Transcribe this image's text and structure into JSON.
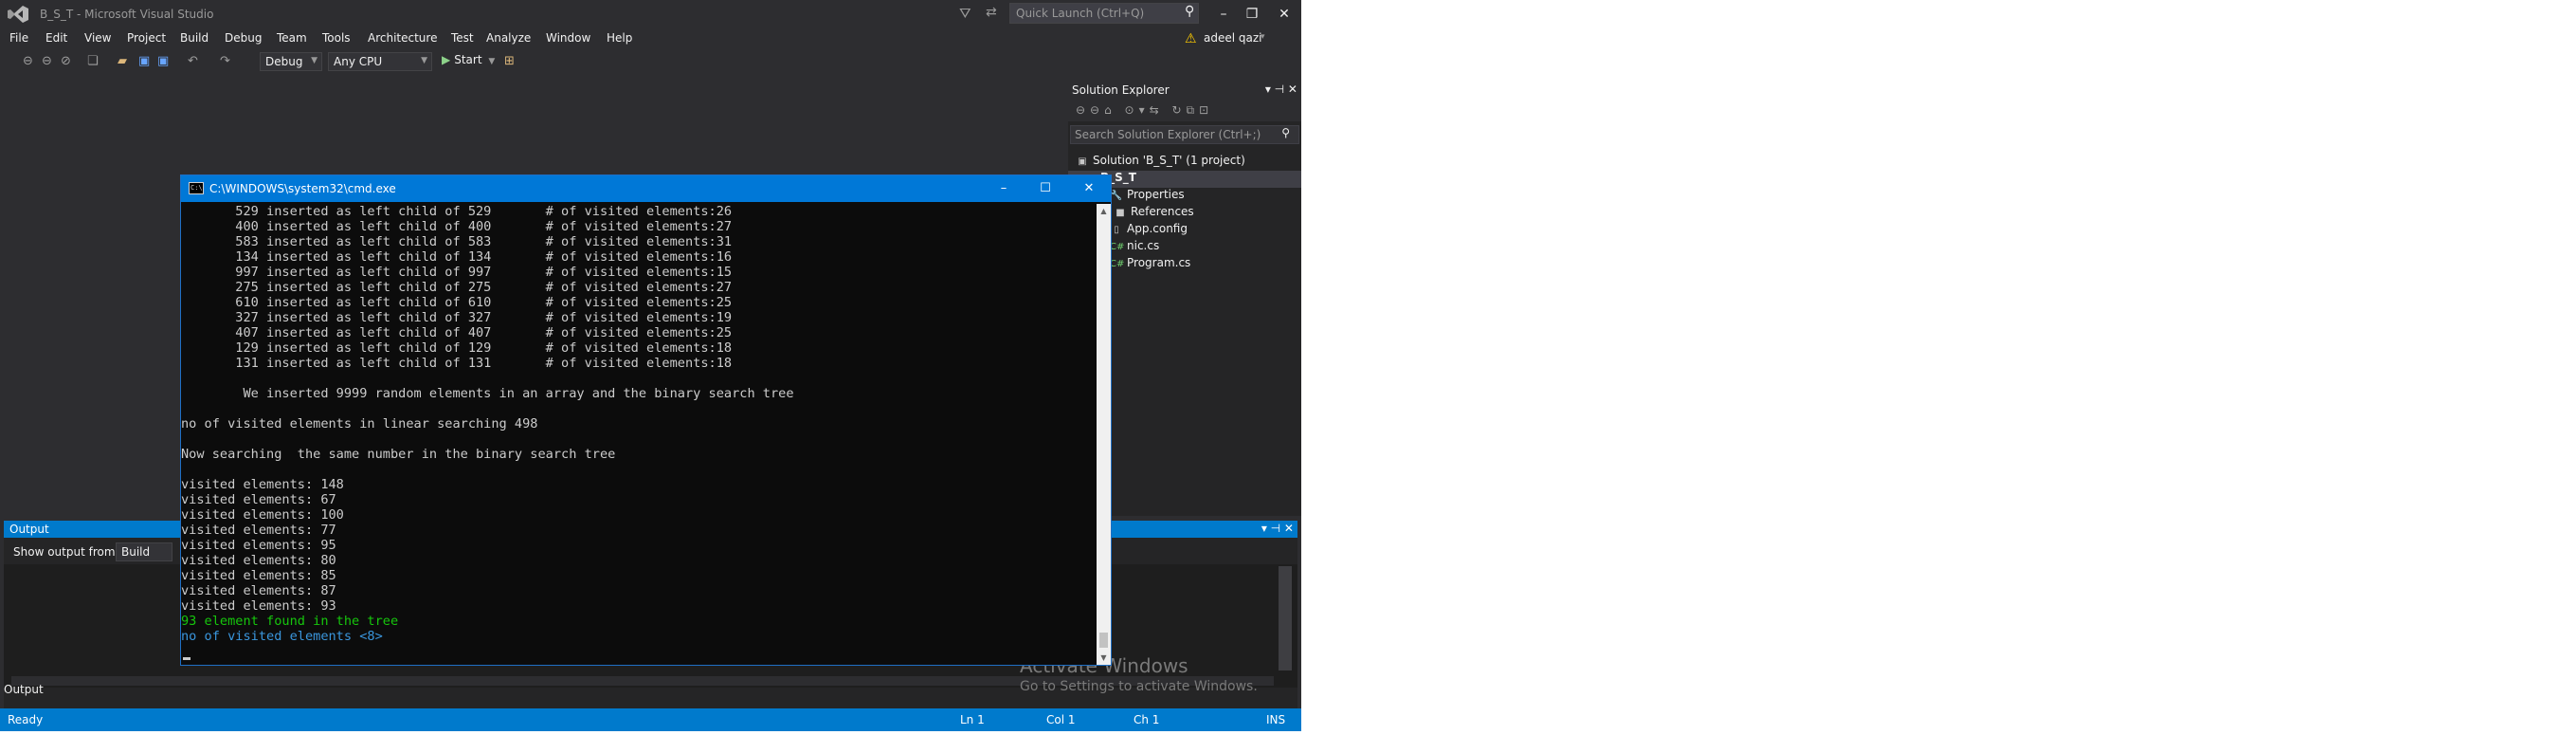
{
  "window": {
    "title": "B_S_T - Microsoft Visual Studio",
    "quick_launch_placeholder": "Quick Launch (Ctrl+Q)",
    "account_name": "adeel qazi",
    "minimize": "–",
    "restore": "❐",
    "close": "✕"
  },
  "menu": [
    "File",
    "Edit",
    "View",
    "Project",
    "Build",
    "Debug",
    "Team",
    "Tools",
    "Architecture",
    "Test",
    "Analyze",
    "Window",
    "Help"
  ],
  "toolbar": {
    "configuration": "Debug",
    "platform": "Any CPU",
    "start_label": "Start"
  },
  "solution_explorer": {
    "title": "Solution Explorer",
    "search_placeholder": "Search Solution Explorer (Ctrl+;)",
    "items": [
      {
        "label": "Solution 'B_S_T' (1 project)",
        "icon": "solution-icon"
      },
      {
        "label": "B_S_T",
        "icon": "csharp-project-icon"
      },
      {
        "label": "Properties",
        "icon": "wrench-icon"
      },
      {
        "label": "References",
        "icon": "references-icon"
      },
      {
        "label": "App.config",
        "icon": "config-file-icon"
      },
      {
        "label": "nic.cs",
        "icon": "csharp-file-icon"
      },
      {
        "label": "Program.cs",
        "icon": "csharp-file-icon"
      }
    ]
  },
  "output": {
    "title": "Output",
    "show_output_from_label": "Show output from:",
    "source": "Build",
    "bottom_tab": "Output"
  },
  "cmd": {
    "title": "C:\\WINDOWS\\system32\\cmd.exe",
    "lines": [
      {
        "text": "       529 inserted as left child of 529       # of visited elements:26",
        "color": "default"
      },
      {
        "text": "       400 inserted as left child of 400       # of visited elements:27",
        "color": "default"
      },
      {
        "text": "       583 inserted as left child of 583       # of visited elements:31",
        "color": "default"
      },
      {
        "text": "       134 inserted as left child of 134       # of visited elements:16",
        "color": "default"
      },
      {
        "text": "       997 inserted as left child of 997       # of visited elements:15",
        "color": "default"
      },
      {
        "text": "       275 inserted as left child of 275       # of visited elements:27",
        "color": "default"
      },
      {
        "text": "       610 inserted as left child of 610       # of visited elements:25",
        "color": "default"
      },
      {
        "text": "       327 inserted as left child of 327       # of visited elements:19",
        "color": "default"
      },
      {
        "text": "       407 inserted as left child of 407       # of visited elements:25",
        "color": "default"
      },
      {
        "text": "       129 inserted as left child of 129       # of visited elements:18",
        "color": "default"
      },
      {
        "text": "       131 inserted as left child of 131       # of visited elements:18",
        "color": "default"
      },
      {
        "text": "",
        "color": "default"
      },
      {
        "text": "        We inserted 9999 random elements in an array and the binary search tree",
        "color": "default"
      },
      {
        "text": "",
        "color": "default"
      },
      {
        "text": "no of visited elements in linear searching 498",
        "color": "default"
      },
      {
        "text": "",
        "color": "default"
      },
      {
        "text": "Now searching  the same number in the binary search tree",
        "color": "default"
      },
      {
        "text": "",
        "color": "default"
      },
      {
        "text": "visited elements: 148",
        "color": "default"
      },
      {
        "text": "visited elements: 67",
        "color": "default"
      },
      {
        "text": "visited elements: 100",
        "color": "default"
      },
      {
        "text": "visited elements: 77",
        "color": "default"
      },
      {
        "text": "visited elements: 95",
        "color": "default"
      },
      {
        "text": "visited elements: 80",
        "color": "default"
      },
      {
        "text": "visited elements: 85",
        "color": "default"
      },
      {
        "text": "visited elements: 87",
        "color": "default"
      },
      {
        "text": "visited elements: 93",
        "color": "default"
      },
      {
        "text": "93 element found in the tree",
        "color": "green"
      },
      {
        "text": "no of visited elements <8>",
        "color": "cyan"
      }
    ]
  },
  "watermark": {
    "title": "Activate Windows",
    "subtitle": "Go to Settings to activate Windows."
  },
  "status": {
    "state": "Ready",
    "line": "Ln 1",
    "col": "Col 1",
    "ch": "Ch 1",
    "mode": "INS"
  },
  "colors": {
    "accent": "#007acc",
    "cmd_titlebar": "#0078d7",
    "ide_background": "#2d2d30",
    "console_background": "#0c0c0c",
    "console_green": "#16c60c",
    "console_cyan": "#3a96dd"
  }
}
